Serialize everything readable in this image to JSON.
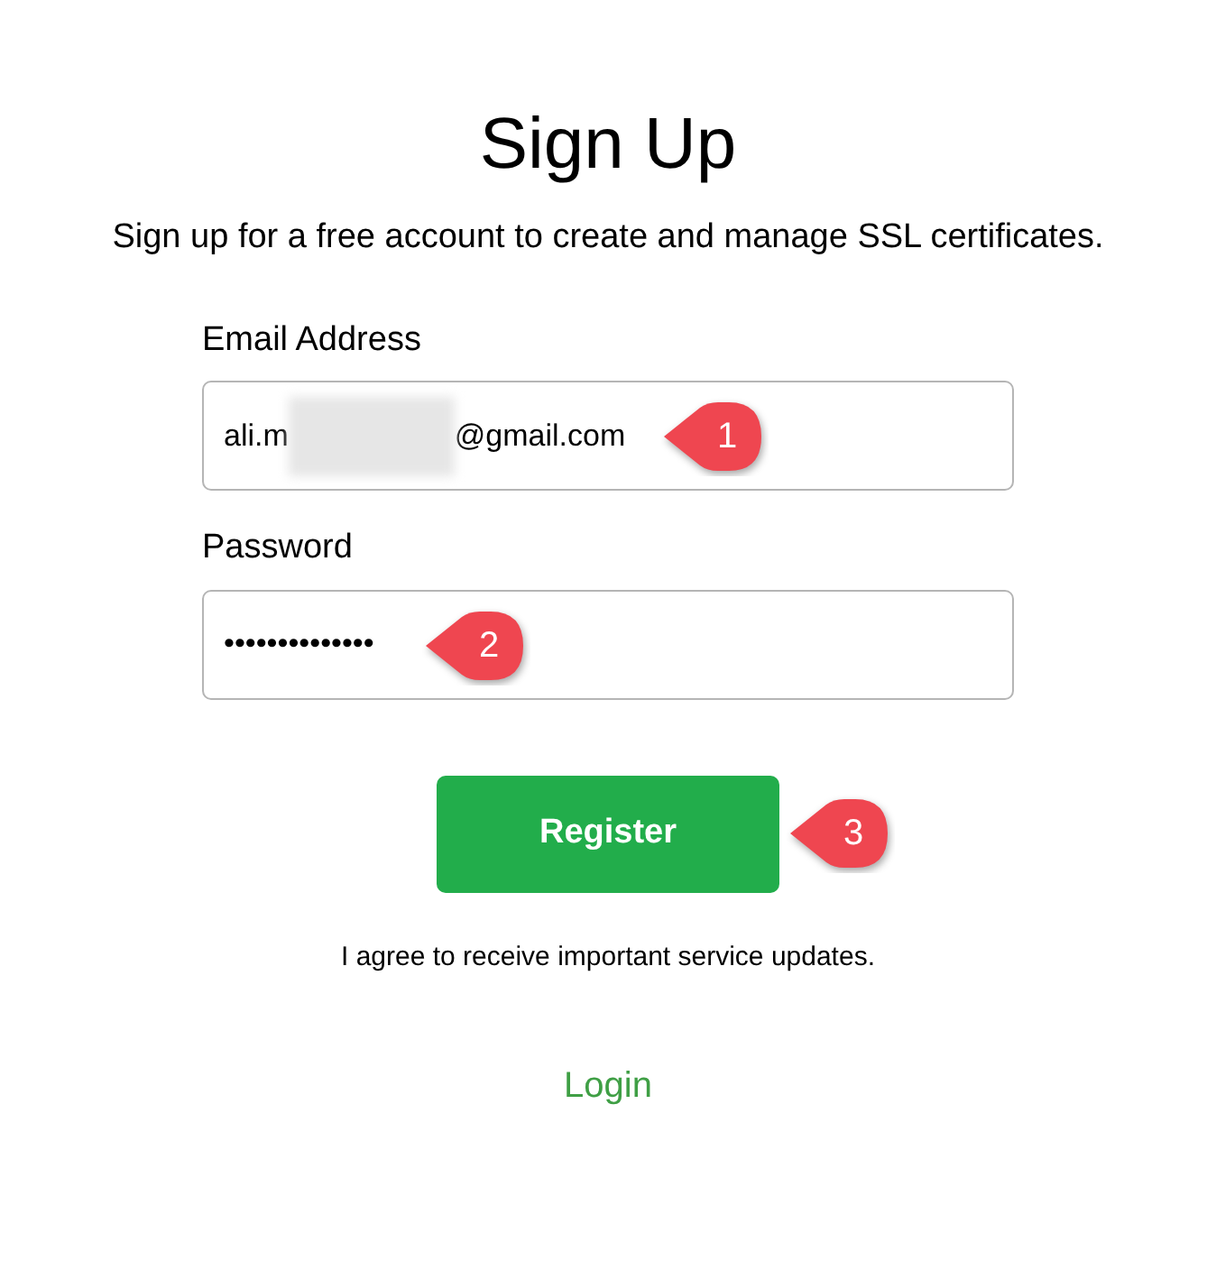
{
  "title": "Sign Up",
  "subtitle": "Sign up for a free account to create and manage SSL certificates.",
  "fields": [
    {
      "label": "Email Address",
      "value_start": "ali.m",
      "redacted": true,
      "value_end": "@gmail.com",
      "callout": "1"
    },
    {
      "label": "Password",
      "value_start": "••••••••••••••",
      "redacted": false,
      "callout": "2"
    }
  ],
  "button": {
    "label": "Register",
    "callout": "3"
  },
  "consent": "I agree to receive important service updates.",
  "login_link": "Login"
}
